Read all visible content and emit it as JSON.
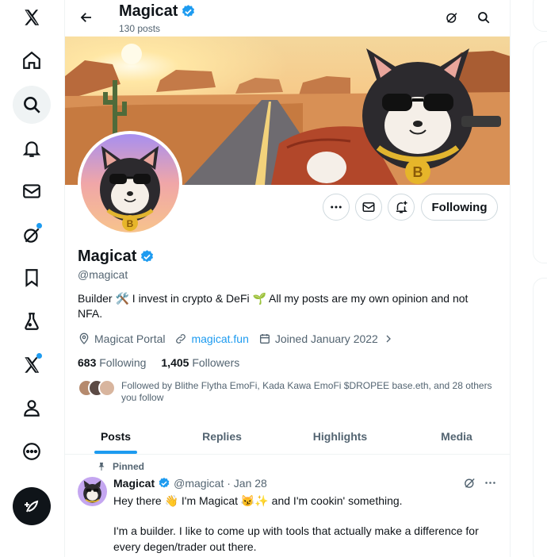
{
  "nav": {
    "items": [
      {
        "name": "x-logo-icon"
      },
      {
        "name": "home-icon"
      },
      {
        "name": "search-icon"
      },
      {
        "name": "bell-icon"
      },
      {
        "name": "mail-icon"
      },
      {
        "name": "grok-icon"
      },
      {
        "name": "bookmark-icon"
      },
      {
        "name": "flask-icon"
      },
      {
        "name": "x-premium-icon"
      },
      {
        "name": "profile-icon"
      },
      {
        "name": "more-icon"
      }
    ]
  },
  "header": {
    "title": "Magicat",
    "posts_count": "130 posts"
  },
  "profile": {
    "name": "Magicat",
    "handle": "@magicat",
    "bio_line1": "Builder 🛠️ I invest in crypto & DeFi 🌱 All my posts are my own opinion and not",
    "bio_line2": "NFA.",
    "location": "Magicat Portal",
    "website": "magicat.fun",
    "joined": "Joined January 2022",
    "following_count": "683",
    "following_label": "Following",
    "followers_count": "1,405",
    "followers_label": "Followers",
    "followed_by": "Followed by Blithe Flytha EmoFi, Kada Kawa EmoFi $DROPEE base.eth, and 28 others you follow",
    "following_button": "Following"
  },
  "tabs": [
    {
      "label": "Posts",
      "active": true
    },
    {
      "label": "Replies",
      "active": false
    },
    {
      "label": "Highlights",
      "active": false
    },
    {
      "label": "Media",
      "active": false
    }
  ],
  "post": {
    "pinned_label": "Pinned",
    "author": "Magicat",
    "handle_date": "@magicat · Jan 28",
    "line1": "Hey there 👋 I'm Magicat 😼✨ and I'm cookin' something.",
    "line2": "I'm a builder. I like to come up with tools that actually make a difference for",
    "line3": "every degen/trader out there."
  },
  "colors": {
    "accent": "#1d9bf0",
    "text": "#0f1419",
    "muted": "#536471",
    "border": "#cfd9de"
  }
}
